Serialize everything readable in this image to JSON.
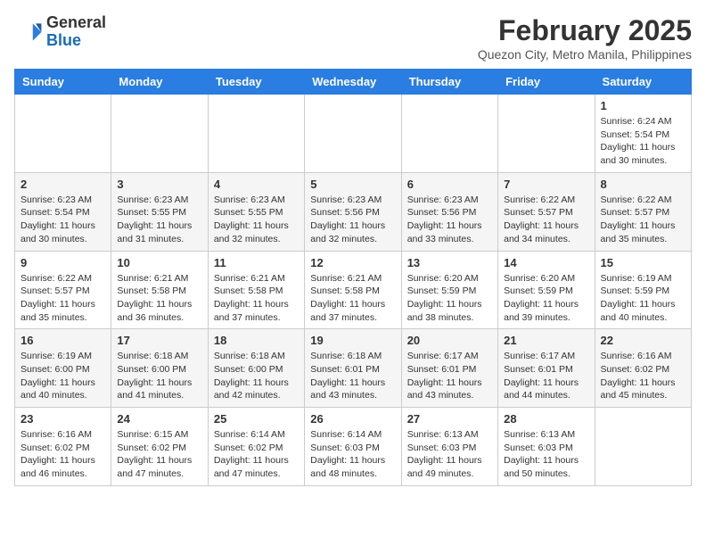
{
  "header": {
    "logo_general": "General",
    "logo_blue": "Blue",
    "month_title": "February 2025",
    "location": "Quezon City, Metro Manila, Philippines"
  },
  "days_of_week": [
    "Sunday",
    "Monday",
    "Tuesday",
    "Wednesday",
    "Thursday",
    "Friday",
    "Saturday"
  ],
  "weeks": [
    [
      {
        "day": "",
        "info": ""
      },
      {
        "day": "",
        "info": ""
      },
      {
        "day": "",
        "info": ""
      },
      {
        "day": "",
        "info": ""
      },
      {
        "day": "",
        "info": ""
      },
      {
        "day": "",
        "info": ""
      },
      {
        "day": "1",
        "info": "Sunrise: 6:24 AM\nSunset: 5:54 PM\nDaylight: 11 hours\nand 30 minutes."
      }
    ],
    [
      {
        "day": "2",
        "info": "Sunrise: 6:23 AM\nSunset: 5:54 PM\nDaylight: 11 hours\nand 30 minutes."
      },
      {
        "day": "3",
        "info": "Sunrise: 6:23 AM\nSunset: 5:55 PM\nDaylight: 11 hours\nand 31 minutes."
      },
      {
        "day": "4",
        "info": "Sunrise: 6:23 AM\nSunset: 5:55 PM\nDaylight: 11 hours\nand 32 minutes."
      },
      {
        "day": "5",
        "info": "Sunrise: 6:23 AM\nSunset: 5:56 PM\nDaylight: 11 hours\nand 32 minutes."
      },
      {
        "day": "6",
        "info": "Sunrise: 6:23 AM\nSunset: 5:56 PM\nDaylight: 11 hours\nand 33 minutes."
      },
      {
        "day": "7",
        "info": "Sunrise: 6:22 AM\nSunset: 5:57 PM\nDaylight: 11 hours\nand 34 minutes."
      },
      {
        "day": "8",
        "info": "Sunrise: 6:22 AM\nSunset: 5:57 PM\nDaylight: 11 hours\nand 35 minutes."
      }
    ],
    [
      {
        "day": "9",
        "info": "Sunrise: 6:22 AM\nSunset: 5:57 PM\nDaylight: 11 hours\nand 35 minutes."
      },
      {
        "day": "10",
        "info": "Sunrise: 6:21 AM\nSunset: 5:58 PM\nDaylight: 11 hours\nand 36 minutes."
      },
      {
        "day": "11",
        "info": "Sunrise: 6:21 AM\nSunset: 5:58 PM\nDaylight: 11 hours\nand 37 minutes."
      },
      {
        "day": "12",
        "info": "Sunrise: 6:21 AM\nSunset: 5:58 PM\nDaylight: 11 hours\nand 37 minutes."
      },
      {
        "day": "13",
        "info": "Sunrise: 6:20 AM\nSunset: 5:59 PM\nDaylight: 11 hours\nand 38 minutes."
      },
      {
        "day": "14",
        "info": "Sunrise: 6:20 AM\nSunset: 5:59 PM\nDaylight: 11 hours\nand 39 minutes."
      },
      {
        "day": "15",
        "info": "Sunrise: 6:19 AM\nSunset: 5:59 PM\nDaylight: 11 hours\nand 40 minutes."
      }
    ],
    [
      {
        "day": "16",
        "info": "Sunrise: 6:19 AM\nSunset: 6:00 PM\nDaylight: 11 hours\nand 40 minutes."
      },
      {
        "day": "17",
        "info": "Sunrise: 6:18 AM\nSunset: 6:00 PM\nDaylight: 11 hours\nand 41 minutes."
      },
      {
        "day": "18",
        "info": "Sunrise: 6:18 AM\nSunset: 6:00 PM\nDaylight: 11 hours\nand 42 minutes."
      },
      {
        "day": "19",
        "info": "Sunrise: 6:18 AM\nSunset: 6:01 PM\nDaylight: 11 hours\nand 43 minutes."
      },
      {
        "day": "20",
        "info": "Sunrise: 6:17 AM\nSunset: 6:01 PM\nDaylight: 11 hours\nand 43 minutes."
      },
      {
        "day": "21",
        "info": "Sunrise: 6:17 AM\nSunset: 6:01 PM\nDaylight: 11 hours\nand 44 minutes."
      },
      {
        "day": "22",
        "info": "Sunrise: 6:16 AM\nSunset: 6:02 PM\nDaylight: 11 hours\nand 45 minutes."
      }
    ],
    [
      {
        "day": "23",
        "info": "Sunrise: 6:16 AM\nSunset: 6:02 PM\nDaylight: 11 hours\nand 46 minutes."
      },
      {
        "day": "24",
        "info": "Sunrise: 6:15 AM\nSunset: 6:02 PM\nDaylight: 11 hours\nand 47 minutes."
      },
      {
        "day": "25",
        "info": "Sunrise: 6:14 AM\nSunset: 6:02 PM\nDaylight: 11 hours\nand 47 minutes."
      },
      {
        "day": "26",
        "info": "Sunrise: 6:14 AM\nSunset: 6:03 PM\nDaylight: 11 hours\nand 48 minutes."
      },
      {
        "day": "27",
        "info": "Sunrise: 6:13 AM\nSunset: 6:03 PM\nDaylight: 11 hours\nand 49 minutes."
      },
      {
        "day": "28",
        "info": "Sunrise: 6:13 AM\nSunset: 6:03 PM\nDaylight: 11 hours\nand 50 minutes."
      },
      {
        "day": "",
        "info": ""
      }
    ]
  ]
}
